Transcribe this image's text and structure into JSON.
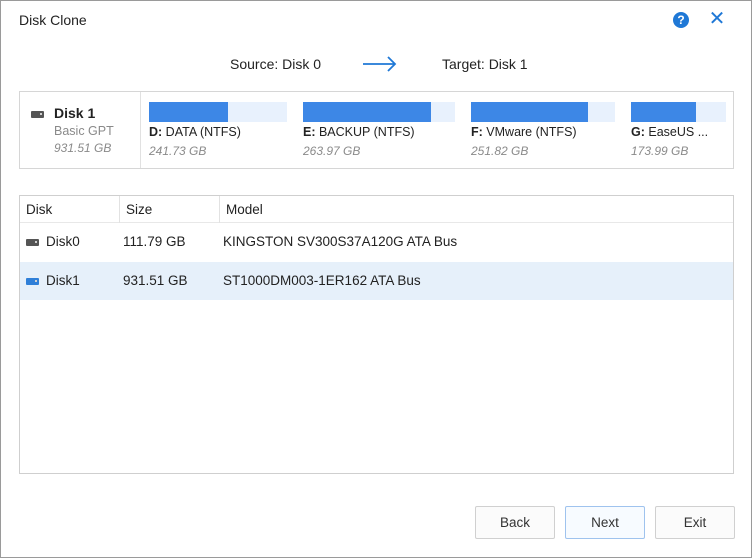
{
  "window": {
    "title": "Disk Clone"
  },
  "header": {
    "source_label": "Source: Disk 0",
    "target_label": "Target: Disk 1"
  },
  "disk_map": {
    "disk_name": "Disk 1",
    "disk_type": "Basic GPT",
    "disk_size": "931.51 GB",
    "partitions": [
      {
        "letter": "D:",
        "name": " DATA (NTFS)",
        "size": "241.73 GB",
        "used_fraction": 0.57
      },
      {
        "letter": "E:",
        "name": " BACKUP (NTFS)",
        "size": "263.97 GB",
        "used_fraction": 0.84
      },
      {
        "letter": "F:",
        "name": " VMware (NTFS)",
        "size": "251.82 GB",
        "used_fraction": 0.81
      },
      {
        "letter": "G:",
        "name": " EaseUS ...",
        "size": "173.99 GB",
        "used_fraction": 0.68
      }
    ]
  },
  "table": {
    "columns": [
      "Disk",
      "Size",
      "Model"
    ],
    "rows": [
      {
        "disk": "Disk0",
        "size": "111.79 GB",
        "model": "KINGSTON SV300S37A120G ATA Bus",
        "selected": false
      },
      {
        "disk": "Disk1",
        "size": "931.51 GB",
        "model": "ST1000DM003-1ER162 ATA Bus",
        "selected": true
      }
    ]
  },
  "buttons": {
    "back": "Back",
    "next": "Next",
    "exit": "Exit"
  },
  "icons": {
    "help": "help-icon",
    "close": "close-icon",
    "arrow": "arrow-right-icon",
    "disk": "hdd-icon"
  },
  "colors": {
    "accent": "#1f78d6",
    "partition_fill": "#3d87e6",
    "partition_free": "#e8f1fd",
    "selected_row": "#e6f0fa"
  }
}
